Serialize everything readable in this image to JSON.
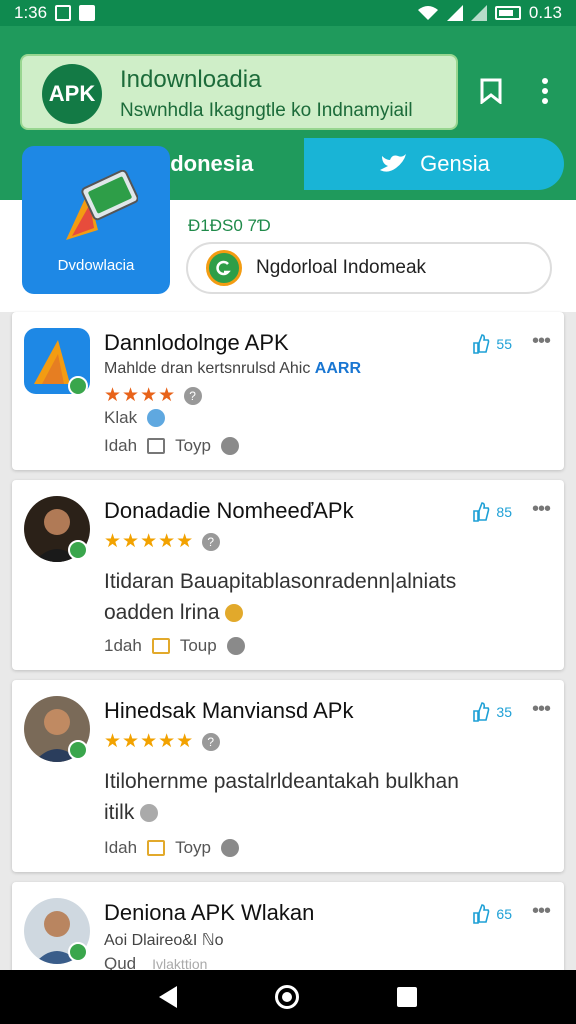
{
  "status_bar": {
    "time": "1:36",
    "battery_text": "0.13"
  },
  "header": {
    "logo_text": "APK",
    "title": "Indownloadia",
    "subtitle": "Nswnhdla Ikagngtle ko Indnamyiail",
    "tabs": [
      {
        "label": "Indonesia"
      },
      {
        "label": "Gensia"
      }
    ]
  },
  "featured": {
    "tile_label": "Dvdowlacia",
    "price": "Đ1ĐS0 7Ɗ",
    "download_label": "Ngdorloal Indomeak"
  },
  "cards": [
    {
      "name": "Dannlodolnge APK",
      "meta": "Mahlde dran kertsnrulsd Ahic",
      "tag": "AARR",
      "stars": "★★★★",
      "desc_lines": [],
      "sub": "Klak",
      "bottom_left": "Idah",
      "bottom_right": "Toyp",
      "likes": "55"
    },
    {
      "name": "Donadadie NomheeďAPk",
      "stars": "★★★★★",
      "desc_lines": [
        "Itidaran Bauapitablasonradenn|alniats",
        "oadden lrina"
      ],
      "bottom_left": "1dah",
      "bottom_right": "Toup",
      "likes": "85"
    },
    {
      "name": "Hinedsak Manviansd APk",
      "stars": "★★★★★",
      "desc_lines": [
        "Itilohernme pastalrldeantakah bulkhan",
        "itilk"
      ],
      "bottom_left": "Idah",
      "bottom_right": "Toyp",
      "likes": "35"
    },
    {
      "name": "Deniona APK Wlakan",
      "meta": "Aoi Dlaireo&I ℕo",
      "sub": "Qud",
      "faint": "Ivlakttion",
      "likes": "65"
    }
  ],
  "colors": {
    "brand": "#1f9a5c",
    "accent": "#19b4d6",
    "star": "#f2a200"
  }
}
